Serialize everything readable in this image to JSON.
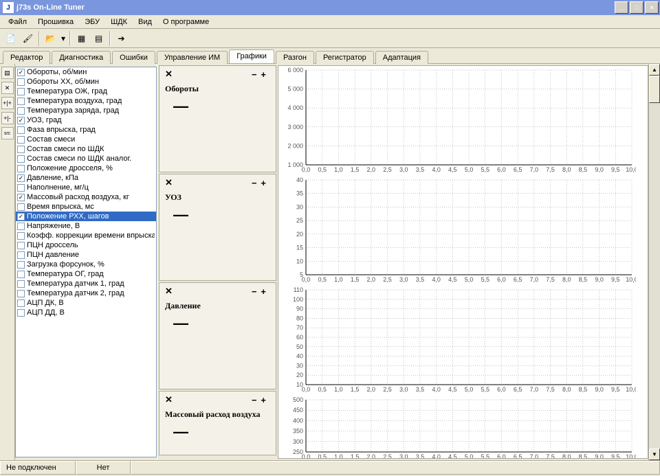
{
  "title": "j73s On-Line Tuner",
  "menu": [
    "Файл",
    "Прошивка",
    "ЭБУ",
    "ШДК",
    "Вид",
    "О программе"
  ],
  "tabs": [
    "Редактор",
    "Диагностика",
    "Ошибки",
    "Управление ИМ",
    "Графики",
    "Разгон",
    "Регистратор",
    "Адаптация"
  ],
  "active_tab": 4,
  "params": [
    {
      "checked": true,
      "selected": false,
      "label": "Обороты, об/мин"
    },
    {
      "checked": false,
      "selected": false,
      "label": "Обороты ХХ, об/мин"
    },
    {
      "checked": false,
      "selected": false,
      "label": "Температура ОЖ, град"
    },
    {
      "checked": false,
      "selected": false,
      "label": "Температура воздуха, град"
    },
    {
      "checked": false,
      "selected": false,
      "label": "Температура заряда, град"
    },
    {
      "checked": true,
      "selected": false,
      "label": "УОЗ, град"
    },
    {
      "checked": false,
      "selected": false,
      "label": "Фаза впрыска, град"
    },
    {
      "checked": false,
      "selected": false,
      "label": "Состав смеси"
    },
    {
      "checked": false,
      "selected": false,
      "label": "Состав смеси по ШДК"
    },
    {
      "checked": false,
      "selected": false,
      "label": "Состав смеси по ШДК аналог."
    },
    {
      "checked": false,
      "selected": false,
      "label": "Положение дросселя, %"
    },
    {
      "checked": true,
      "selected": false,
      "label": "Давление, кПа"
    },
    {
      "checked": false,
      "selected": false,
      "label": "Наполнение, мг/ц"
    },
    {
      "checked": true,
      "selected": false,
      "label": "Массовый расход воздуха, кг"
    },
    {
      "checked": false,
      "selected": false,
      "label": "Время впрыска, мс"
    },
    {
      "checked": true,
      "selected": true,
      "label": "Положение РХХ, шагов"
    },
    {
      "checked": false,
      "selected": false,
      "label": "Напряжение, В"
    },
    {
      "checked": false,
      "selected": false,
      "label": "Коэфф. коррекции времени впрыска"
    },
    {
      "checked": false,
      "selected": false,
      "label": "ПЦН дроссель"
    },
    {
      "checked": false,
      "selected": false,
      "label": "ПЦН давление"
    },
    {
      "checked": false,
      "selected": false,
      "label": "Загрузка форсунок, %"
    },
    {
      "checked": false,
      "selected": false,
      "label": "Температура ОГ, град"
    },
    {
      "checked": false,
      "selected": false,
      "label": "Температура датчик 1, град"
    },
    {
      "checked": false,
      "selected": false,
      "label": "Температура датчик 2, град"
    },
    {
      "checked": false,
      "selected": false,
      "label": "АЦП ДК, В"
    },
    {
      "checked": false,
      "selected": false,
      "label": "АЦП ДД, В"
    }
  ],
  "status": {
    "conn": "Не подключен",
    "mode": "Нет"
  },
  "chart_data": [
    {
      "type": "line",
      "title": "Обороты",
      "x_range": [
        0.0,
        10.0
      ],
      "x_step": 0.5,
      "y_ticks": [
        1000,
        2000,
        3000,
        4000,
        5000,
        6000
      ],
      "series": [
        {
          "name": "Обороты",
          "values": []
        }
      ],
      "height": 160
    },
    {
      "type": "line",
      "title": "УОЗ",
      "x_range": [
        0.0,
        10.0
      ],
      "x_step": 0.5,
      "y_ticks": [
        5,
        10,
        15,
        20,
        25,
        30,
        35,
        40
      ],
      "series": [
        {
          "name": "УОЗ",
          "values": []
        }
      ],
      "height": 160
    },
    {
      "type": "line",
      "title": "Давление",
      "x_range": [
        0.0,
        10.0
      ],
      "x_step": 0.5,
      "y_ticks": [
        10,
        20,
        30,
        40,
        50,
        60,
        70,
        80,
        90,
        100,
        110
      ],
      "series": [
        {
          "name": "Давление",
          "values": []
        }
      ],
      "height": 160
    },
    {
      "type": "line",
      "title": "Массовый расход воздуха",
      "x_range": [
        0.0,
        10.0
      ],
      "x_step": 0.5,
      "y_ticks": [
        250,
        300,
        350,
        400,
        450,
        500
      ],
      "series": [
        {
          "name": "Массовый расход воздуха",
          "values": []
        }
      ],
      "height": 98
    }
  ]
}
